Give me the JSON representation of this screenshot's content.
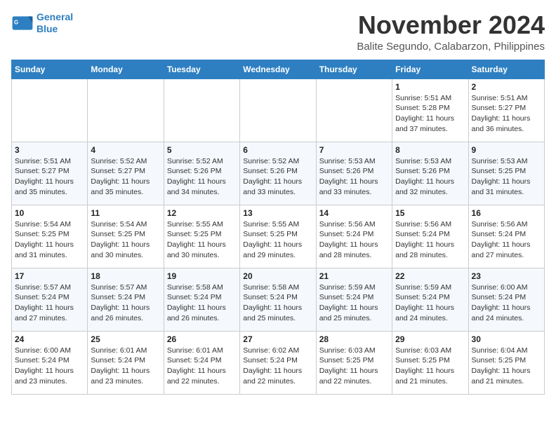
{
  "logo": {
    "line1": "General",
    "line2": "Blue"
  },
  "title": "November 2024",
  "location": "Balite Segundo, Calabarzon, Philippines",
  "weekdays": [
    "Sunday",
    "Monday",
    "Tuesday",
    "Wednesday",
    "Thursday",
    "Friday",
    "Saturday"
  ],
  "weeks": [
    [
      null,
      null,
      null,
      null,
      null,
      {
        "day": "1",
        "sunrise": "5:51 AM",
        "sunset": "5:28 PM",
        "daylight": "11 hours and 37 minutes."
      },
      {
        "day": "2",
        "sunrise": "5:51 AM",
        "sunset": "5:27 PM",
        "daylight": "11 hours and 36 minutes."
      }
    ],
    [
      {
        "day": "3",
        "sunrise": "5:51 AM",
        "sunset": "5:27 PM",
        "daylight": "11 hours and 35 minutes."
      },
      {
        "day": "4",
        "sunrise": "5:52 AM",
        "sunset": "5:27 PM",
        "daylight": "11 hours and 35 minutes."
      },
      {
        "day": "5",
        "sunrise": "5:52 AM",
        "sunset": "5:26 PM",
        "daylight": "11 hours and 34 minutes."
      },
      {
        "day": "6",
        "sunrise": "5:52 AM",
        "sunset": "5:26 PM",
        "daylight": "11 hours and 33 minutes."
      },
      {
        "day": "7",
        "sunrise": "5:53 AM",
        "sunset": "5:26 PM",
        "daylight": "11 hours and 33 minutes."
      },
      {
        "day": "8",
        "sunrise": "5:53 AM",
        "sunset": "5:26 PM",
        "daylight": "11 hours and 32 minutes."
      },
      {
        "day": "9",
        "sunrise": "5:53 AM",
        "sunset": "5:25 PM",
        "daylight": "11 hours and 31 minutes."
      }
    ],
    [
      {
        "day": "10",
        "sunrise": "5:54 AM",
        "sunset": "5:25 PM",
        "daylight": "11 hours and 31 minutes."
      },
      {
        "day": "11",
        "sunrise": "5:54 AM",
        "sunset": "5:25 PM",
        "daylight": "11 hours and 30 minutes."
      },
      {
        "day": "12",
        "sunrise": "5:55 AM",
        "sunset": "5:25 PM",
        "daylight": "11 hours and 30 minutes."
      },
      {
        "day": "13",
        "sunrise": "5:55 AM",
        "sunset": "5:25 PM",
        "daylight": "11 hours and 29 minutes."
      },
      {
        "day": "14",
        "sunrise": "5:56 AM",
        "sunset": "5:24 PM",
        "daylight": "11 hours and 28 minutes."
      },
      {
        "day": "15",
        "sunrise": "5:56 AM",
        "sunset": "5:24 PM",
        "daylight": "11 hours and 28 minutes."
      },
      {
        "day": "16",
        "sunrise": "5:56 AM",
        "sunset": "5:24 PM",
        "daylight": "11 hours and 27 minutes."
      }
    ],
    [
      {
        "day": "17",
        "sunrise": "5:57 AM",
        "sunset": "5:24 PM",
        "daylight": "11 hours and 27 minutes."
      },
      {
        "day": "18",
        "sunrise": "5:57 AM",
        "sunset": "5:24 PM",
        "daylight": "11 hours and 26 minutes."
      },
      {
        "day": "19",
        "sunrise": "5:58 AM",
        "sunset": "5:24 PM",
        "daylight": "11 hours and 26 minutes."
      },
      {
        "day": "20",
        "sunrise": "5:58 AM",
        "sunset": "5:24 PM",
        "daylight": "11 hours and 25 minutes."
      },
      {
        "day": "21",
        "sunrise": "5:59 AM",
        "sunset": "5:24 PM",
        "daylight": "11 hours and 25 minutes."
      },
      {
        "day": "22",
        "sunrise": "5:59 AM",
        "sunset": "5:24 PM",
        "daylight": "11 hours and 24 minutes."
      },
      {
        "day": "23",
        "sunrise": "6:00 AM",
        "sunset": "5:24 PM",
        "daylight": "11 hours and 24 minutes."
      }
    ],
    [
      {
        "day": "24",
        "sunrise": "6:00 AM",
        "sunset": "5:24 PM",
        "daylight": "11 hours and 23 minutes."
      },
      {
        "day": "25",
        "sunrise": "6:01 AM",
        "sunset": "5:24 PM",
        "daylight": "11 hours and 23 minutes."
      },
      {
        "day": "26",
        "sunrise": "6:01 AM",
        "sunset": "5:24 PM",
        "daylight": "11 hours and 22 minutes."
      },
      {
        "day": "27",
        "sunrise": "6:02 AM",
        "sunset": "5:24 PM",
        "daylight": "11 hours and 22 minutes."
      },
      {
        "day": "28",
        "sunrise": "6:03 AM",
        "sunset": "5:25 PM",
        "daylight": "11 hours and 22 minutes."
      },
      {
        "day": "29",
        "sunrise": "6:03 AM",
        "sunset": "5:25 PM",
        "daylight": "11 hours and 21 minutes."
      },
      {
        "day": "30",
        "sunrise": "6:04 AM",
        "sunset": "5:25 PM",
        "daylight": "11 hours and 21 minutes."
      }
    ]
  ]
}
